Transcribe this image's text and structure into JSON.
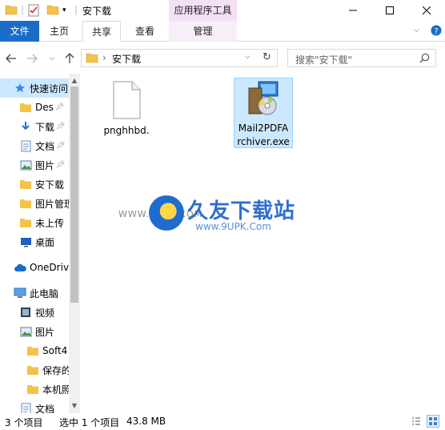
{
  "window": {
    "title": "安下载",
    "context_group": "应用程序工具"
  },
  "ribbon": {
    "tabs": [
      {
        "label": "文件"
      },
      {
        "label": "主页"
      },
      {
        "label": "共享"
      },
      {
        "label": "查看"
      },
      {
        "label": "管理"
      }
    ]
  },
  "addressbar": {
    "path": "安下载",
    "search_placeholder": "搜索\"安下载\""
  },
  "navpane": {
    "items": [
      {
        "label": "快速访问",
        "icon": "star-icon"
      },
      {
        "label": "Des",
        "icon": "folder-icon",
        "pinned": true
      },
      {
        "label": "下载",
        "icon": "download-arrow-icon",
        "pinned": true
      },
      {
        "label": "文档",
        "icon": "document-icon",
        "pinned": true
      },
      {
        "label": "图片",
        "icon": "pictures-icon",
        "pinned": true
      },
      {
        "label": "安下载",
        "icon": "folder-icon"
      },
      {
        "label": "图片管理",
        "icon": "folder-icon"
      },
      {
        "label": "未上传",
        "icon": "folder-icon"
      },
      {
        "label": "桌面",
        "icon": "desktop-icon"
      },
      {
        "label": "OneDrive",
        "icon": "cloud-icon"
      },
      {
        "label": "此电脑",
        "icon": "computer-icon"
      },
      {
        "label": "视频",
        "icon": "video-icon"
      },
      {
        "label": "图片",
        "icon": "pictures-icon"
      },
      {
        "label": "Soft4",
        "icon": "folder-icon"
      },
      {
        "label": "保存的",
        "icon": "folder-icon"
      },
      {
        "label": "本机照",
        "icon": "folder-icon"
      },
      {
        "label": "文档",
        "icon": "document-icon"
      }
    ]
  },
  "files": [
    {
      "name": "pnghhbd.",
      "icon": "blank-file-icon",
      "selected": false
    },
    {
      "name": "Mail2PDFArchiver.exe",
      "icon": "installer-icon",
      "selected": true
    }
  ],
  "watermark": {
    "prefix": "WWW.9UPK.COM",
    "brand": "久友下载站",
    "url": "www.9UPK.Com"
  },
  "statusbar": {
    "item_count": "3 个项目",
    "selection": "选中 1 个项目",
    "size": "43.8 MB"
  },
  "colors": {
    "file_tab": "#1a6dc6",
    "selection": "#cce8ff",
    "context_tab": "#f3e0f5",
    "folder": "#f3c24b"
  }
}
